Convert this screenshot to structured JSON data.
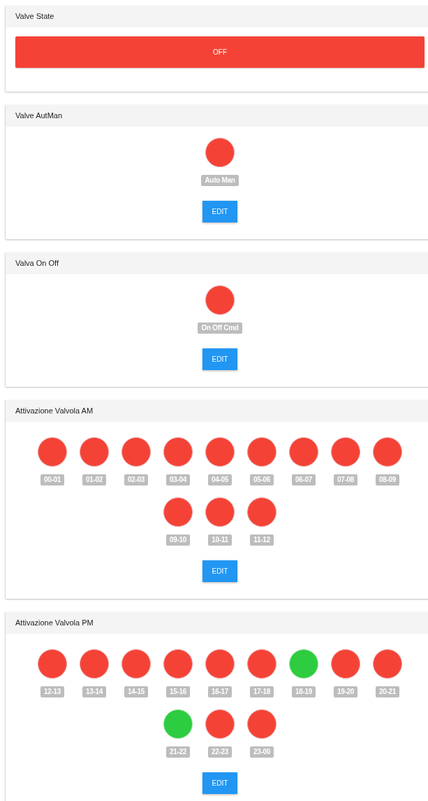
{
  "cards": [
    {
      "title": "Valve State",
      "kind": "state",
      "state": {
        "text": "OFF",
        "on": false
      }
    },
    {
      "title": "Valve AutMan",
      "kind": "leds",
      "leds": [
        {
          "label": "Auto Man",
          "on": false
        }
      ],
      "button": "EDIT"
    },
    {
      "title": "Valva On Off",
      "kind": "leds",
      "leds": [
        {
          "label": "On Off Cmd",
          "on": false
        }
      ],
      "button": "EDIT"
    },
    {
      "title": "Attivazione Valvola AM",
      "kind": "leds",
      "leds": [
        {
          "label": "00-01",
          "on": false
        },
        {
          "label": "01-02",
          "on": false
        },
        {
          "label": "02-03",
          "on": false
        },
        {
          "label": "03-04",
          "on": false
        },
        {
          "label": "04-05",
          "on": false
        },
        {
          "label": "05-06",
          "on": false
        },
        {
          "label": "06-07",
          "on": false
        },
        {
          "label": "07-08",
          "on": false
        },
        {
          "label": "08-09",
          "on": false
        },
        {
          "label": "09-10",
          "on": false
        },
        {
          "label": "10-11",
          "on": false
        },
        {
          "label": "11-12",
          "on": false
        }
      ],
      "button": "EDIT"
    },
    {
      "title": "Attivazione Valvola PM",
      "kind": "leds",
      "leds": [
        {
          "label": "12-13",
          "on": false
        },
        {
          "label": "13-14",
          "on": false
        },
        {
          "label": "14-15",
          "on": false
        },
        {
          "label": "15-16",
          "on": false
        },
        {
          "label": "16-17",
          "on": false
        },
        {
          "label": "17-18",
          "on": false
        },
        {
          "label": "18-19",
          "on": true
        },
        {
          "label": "19-20",
          "on": false
        },
        {
          "label": "20-21",
          "on": false
        },
        {
          "label": "21-22",
          "on": true
        },
        {
          "label": "22-23",
          "on": false
        },
        {
          "label": "23-00",
          "on": false
        }
      ],
      "button": "EDIT"
    }
  ]
}
